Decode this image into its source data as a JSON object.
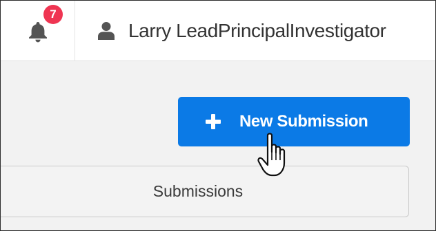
{
  "header": {
    "notifications": {
      "icon": "bell-icon",
      "badge_count": "7",
      "badge_color": "#ef3552"
    },
    "user": {
      "icon": "user-icon",
      "name": "Larry LeadPrincipalInvestigator"
    }
  },
  "main": {
    "new_submission_button": {
      "icon": "plus-icon",
      "label": "New Submission",
      "color": "#0b7ae6"
    },
    "submissions_tab": {
      "label": "Submissions"
    }
  },
  "cursor": {
    "icon": "hand-pointer-cursor-icon"
  }
}
